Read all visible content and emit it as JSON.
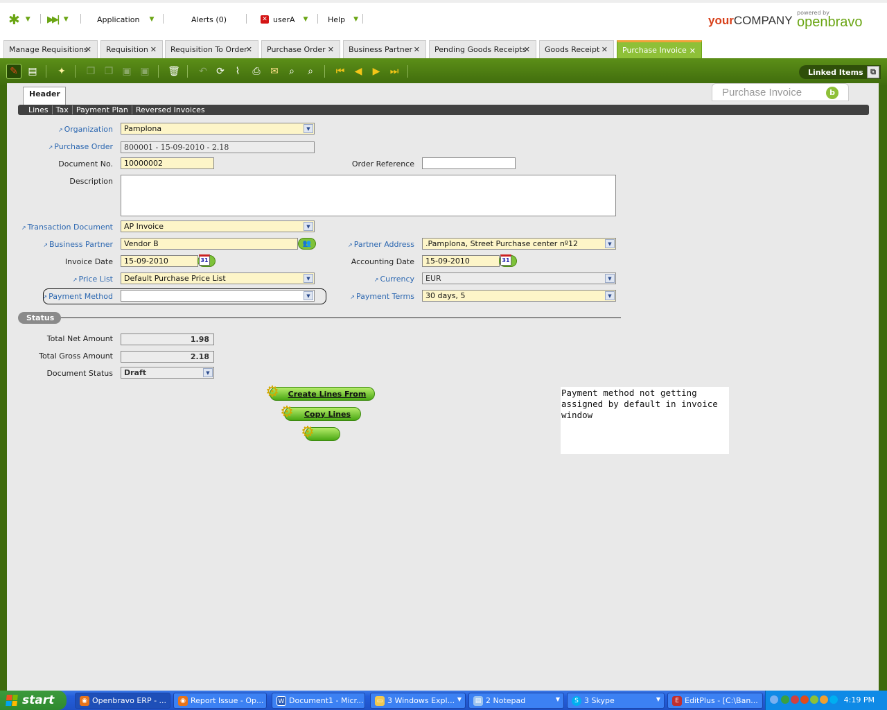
{
  "topbar": {
    "application": "Application",
    "alerts": "Alerts (0)",
    "user": "userA",
    "help": "Help",
    "company_your": "your",
    "company_rest": "COMPANY",
    "powered_by": "powered by",
    "brand": "openbravo"
  },
  "tabs": [
    {
      "label": "Manage Requisitions"
    },
    {
      "label": "Requisition"
    },
    {
      "label": "Requisition To Order"
    },
    {
      "label": "Purchase Order"
    },
    {
      "label": "Business Partner"
    },
    {
      "label": "Pending Goods Receipts"
    },
    {
      "label": "Goods Receipt"
    },
    {
      "label": "Purchase Invoice"
    }
  ],
  "toolbar": {
    "linked_items": "Linked Items"
  },
  "window": {
    "header_tab": "Header",
    "title": "Purchase Invoice",
    "subtabs": [
      "Lines",
      "Tax",
      "Payment Plan",
      "Reversed Invoices"
    ]
  },
  "form": {
    "organization": {
      "label": "Organization",
      "value": "Pamplona"
    },
    "purchase_order": {
      "label": "Purchase Order",
      "value": "800001 - 15-09-2010 - 2.18"
    },
    "document_no": {
      "label": "Document No.",
      "value": "10000002"
    },
    "order_reference": {
      "label": "Order Reference",
      "value": ""
    },
    "description": {
      "label": "Description",
      "value": ""
    },
    "transaction_document": {
      "label": "Transaction Document",
      "value": "AP Invoice"
    },
    "business_partner": {
      "label": "Business Partner",
      "value": "Vendor B"
    },
    "partner_address": {
      "label": "Partner Address",
      "value": ".Pamplona, Street Purchase center nº12"
    },
    "invoice_date": {
      "label": "Invoice Date",
      "value": "15-09-2010"
    },
    "accounting_date": {
      "label": "Accounting Date",
      "value": "15-09-2010"
    },
    "price_list": {
      "label": "Price List",
      "value": "Default Purchase Price List"
    },
    "currency": {
      "label": "Currency",
      "value": "EUR"
    },
    "payment_method": {
      "label": "Payment Method",
      "value": ""
    },
    "payment_terms": {
      "label": "Payment Terms",
      "value": "30 days, 5"
    },
    "calendar_day": "31"
  },
  "status": {
    "section": "Status",
    "total_net": {
      "label": "Total Net Amount",
      "value": "1.98"
    },
    "total_gross": {
      "label": "Total Gross Amount",
      "value": "2.18"
    },
    "doc_status": {
      "label": "Document Status",
      "value": "Draft"
    }
  },
  "actions": {
    "create_lines_from": "Create Lines From",
    "copy_lines": "Copy Lines",
    "empty": ""
  },
  "note": "Payment method not getting\nassigned by default in invoice\nwindow",
  "taskbar": {
    "start": "start",
    "tasks": [
      {
        "label": "Openbravo ERP - ..."
      },
      {
        "label": "Report Issue - Op..."
      },
      {
        "label": "Document1 - Micr..."
      },
      {
        "label": "3 Windows Expl..."
      },
      {
        "label": "2 Notepad"
      },
      {
        "label": "3 Skype"
      },
      {
        "label": "EditPlus - [C:\\Ban..."
      }
    ],
    "clock": "4:19 PM"
  },
  "colors": {
    "brand_green": "#6aa513",
    "frame_green": "#3e6a0c",
    "active_tab": "#8ec038",
    "required_field": "#fdf5c8",
    "link_label": "#2a66b0"
  }
}
